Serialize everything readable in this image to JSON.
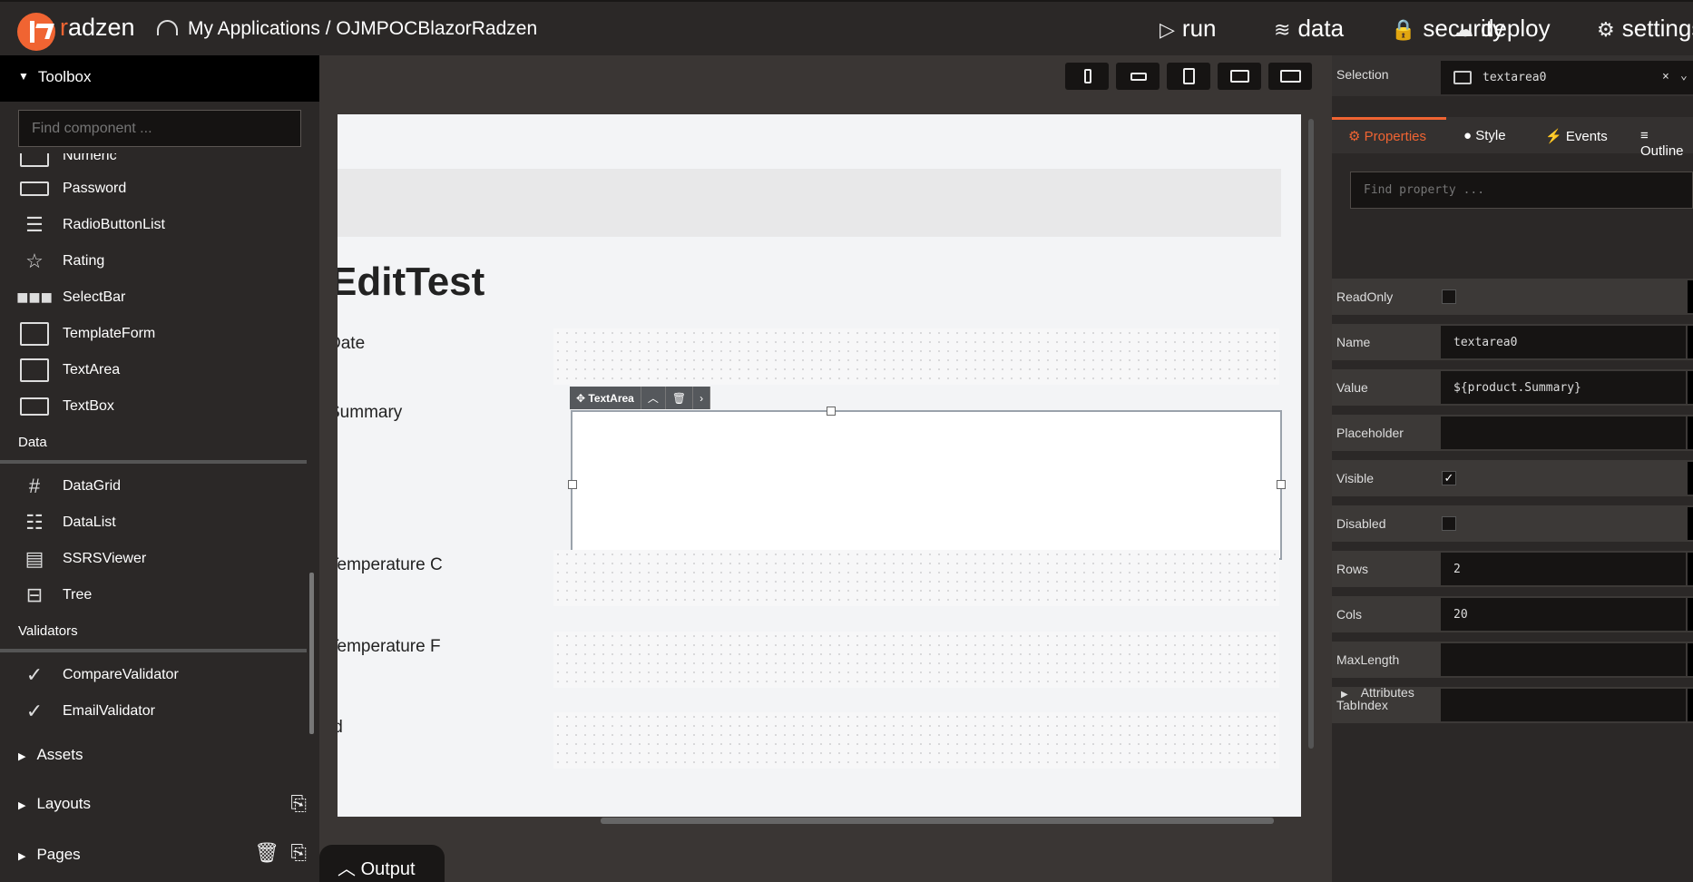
{
  "brand": {
    "name_first": "r",
    "name_rest": "adzen"
  },
  "breadcrumb": "My Applications / OJMPOCBlazorRadzen",
  "nav": [
    {
      "icon": "play-icon",
      "glyph": "▷",
      "label": "run"
    },
    {
      "icon": "layers-icon",
      "glyph": "≋",
      "label": "data"
    },
    {
      "icon": "lock-icon",
      "glyph": "🔒",
      "label": "security"
    },
    {
      "icon": "cloud-upload-icon",
      "glyph": "☁",
      "label": "deploy"
    },
    {
      "icon": "gear-icon",
      "glyph": "⚙",
      "label": "settings"
    }
  ],
  "toolbox": {
    "title": "Toolbox",
    "search_placeholder": "Find component ...",
    "partial_item": "Numeric",
    "items": [
      "Password",
      "RadioButtonList",
      "Rating",
      "SelectBar",
      "TemplateForm",
      "TextArea",
      "TextBox"
    ],
    "data_section": "Data",
    "data_items": [
      "DataGrid",
      "DataList",
      "SSRSViewer",
      "Tree"
    ],
    "validators_section": "Validators",
    "validator_items": [
      "CompareValidator",
      "EmailValidator"
    ]
  },
  "panels": {
    "assets": "Assets",
    "layouts": "Layouts",
    "pages": "Pages"
  },
  "output": "Output",
  "canvas": {
    "title": "EditTest",
    "labels": [
      "Date",
      "Summary",
      "Temperature C",
      "Temperature F",
      "Id"
    ],
    "textarea_toolbar_label": "TextArea"
  },
  "properties": {
    "selection_label": "Selection",
    "selected": "textarea0",
    "tabs": [
      "Properties",
      "Style",
      "Events",
      "Outline"
    ],
    "find_placeholder": "Find property ...",
    "rows": [
      {
        "name": "ReadOnly",
        "type": "check",
        "checked": false
      },
      {
        "name": "Name",
        "type": "text",
        "value": "textarea0"
      },
      {
        "name": "Value",
        "type": "text",
        "value": "${product.Summary}"
      },
      {
        "name": "Placeholder",
        "type": "text",
        "value": ""
      },
      {
        "name": "Visible",
        "type": "check",
        "checked": true
      },
      {
        "name": "Disabled",
        "type": "check",
        "checked": false
      },
      {
        "name": "Rows",
        "type": "text",
        "value": "2"
      },
      {
        "name": "Cols",
        "type": "text",
        "value": "20"
      },
      {
        "name": "MaxLength",
        "type": "text",
        "value": ""
      },
      {
        "name": "TabIndex",
        "type": "text",
        "value": ""
      }
    ],
    "attributes": "Attributes",
    "check_glyph": "✓"
  },
  "colors": {
    "accent": "#f06432",
    "background": "#2b2827"
  }
}
